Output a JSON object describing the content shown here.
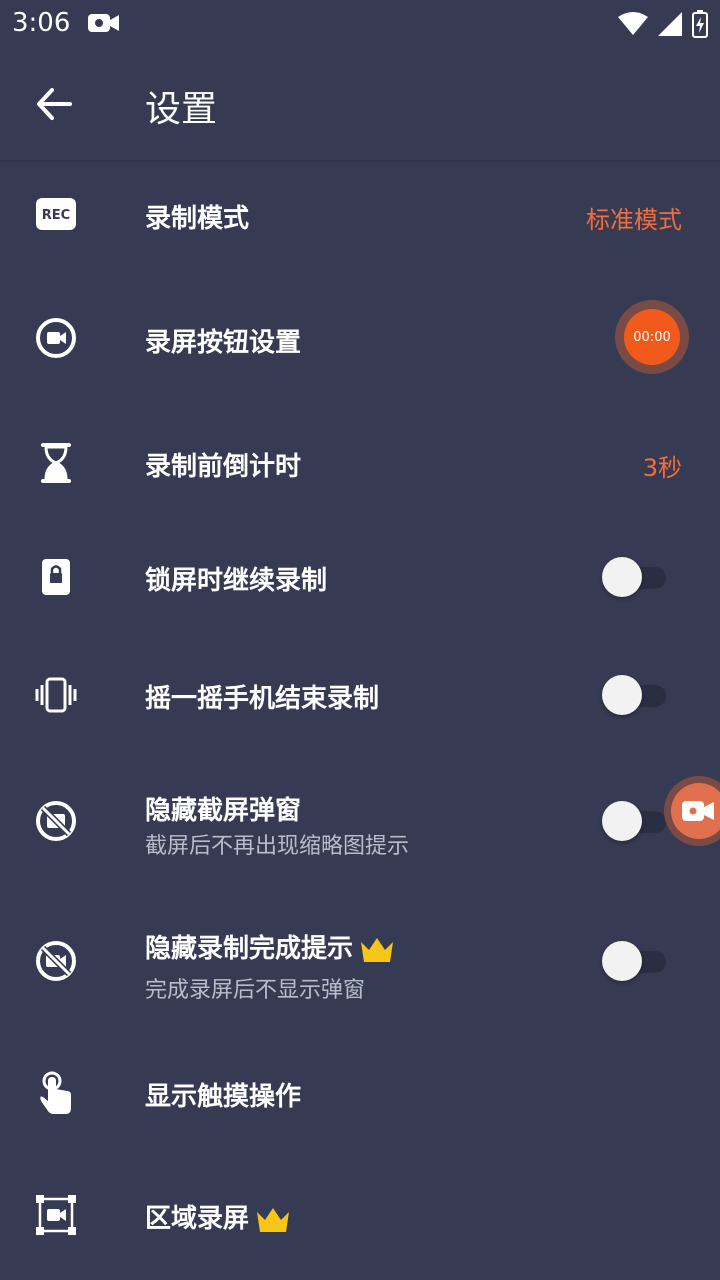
{
  "status": {
    "time": "3:06"
  },
  "appbar": {
    "title": "设置"
  },
  "rows": {
    "record_mode": {
      "label": "录制模式",
      "value": "标准模式",
      "icon": "rec-icon"
    },
    "record_button": {
      "label": "录屏按钮设置",
      "button_text": "00:00",
      "icon": "camera-circle-icon"
    },
    "countdown": {
      "label": "录制前倒计时",
      "value": "3秒",
      "icon": "hourglass-icon"
    },
    "lock_continue": {
      "label": "锁屏时继续录制",
      "toggle": "off",
      "icon": "lock-icon"
    },
    "shake_stop": {
      "label": "摇一摇手机结束录制",
      "toggle": "off",
      "icon": "vibrate-icon"
    },
    "hide_screenshot_popup": {
      "label": "隐藏截屏弹窗",
      "sub": "截屏后不再出现缩略图提示",
      "toggle": "off",
      "icon": "hide-screenshot-icon"
    },
    "hide_finish_tip": {
      "label": "隐藏录制完成提示",
      "sub": "完成录屏后不显示弹窗",
      "toggle": "off",
      "premium": true,
      "icon": "hide-video-icon"
    },
    "show_touch": {
      "label": "显示触摸操作",
      "icon": "touch-icon"
    },
    "area_record": {
      "label": "区域录屏",
      "premium": true,
      "icon": "area-record-icon"
    }
  },
  "colors": {
    "background": "#363b53",
    "accent": "#f26d3d",
    "crown": "#f5c518"
  }
}
